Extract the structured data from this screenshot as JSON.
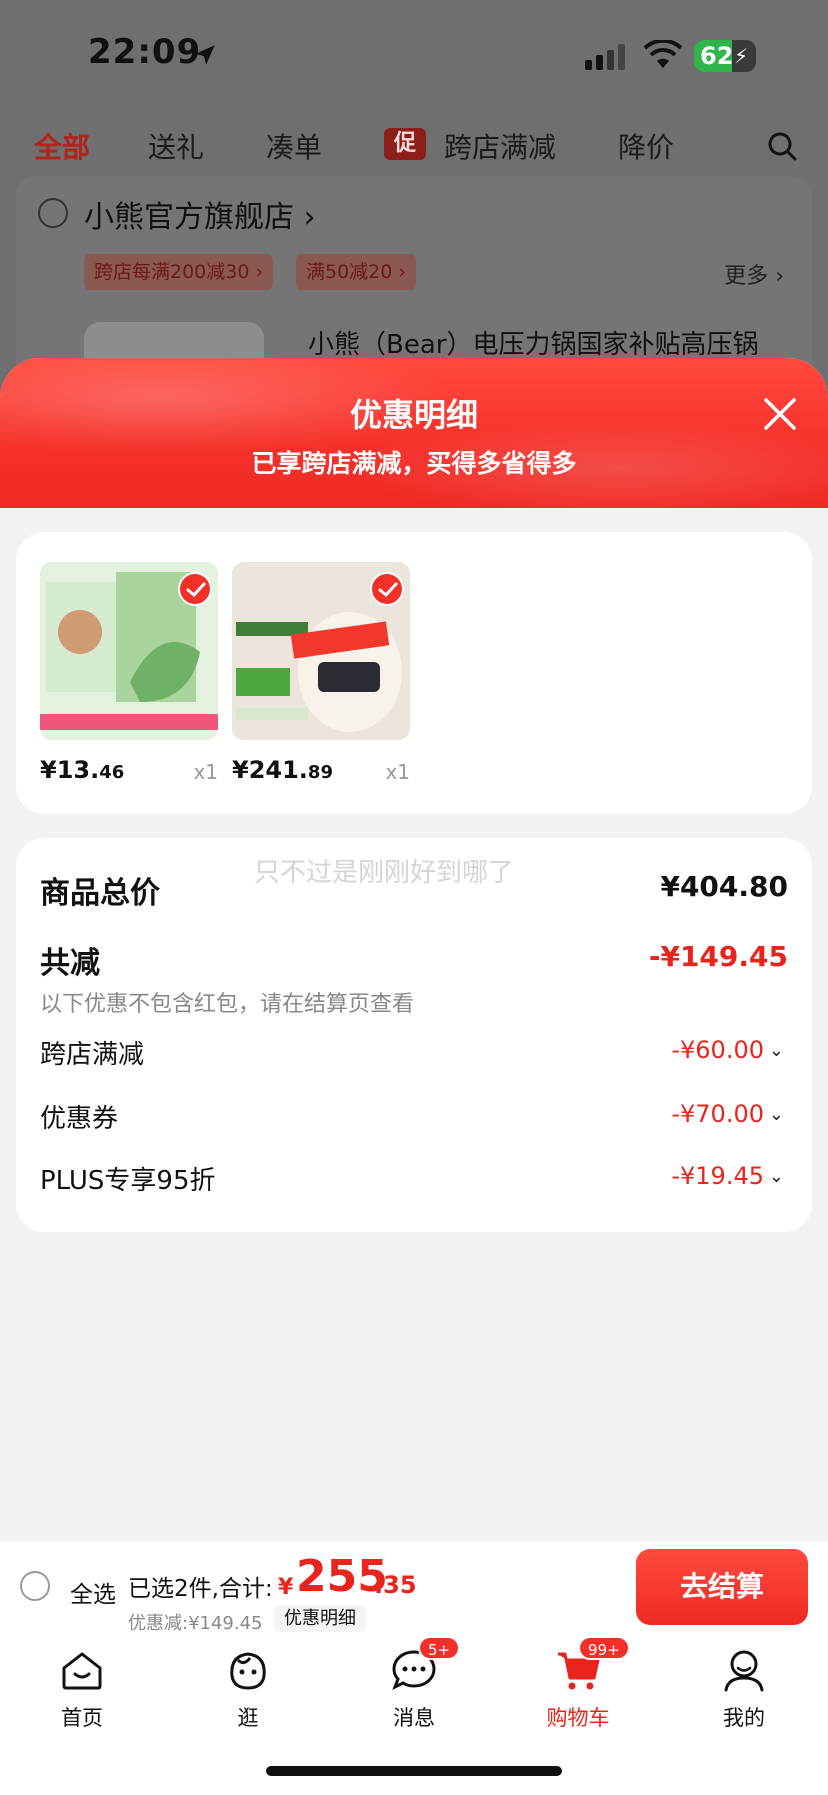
{
  "status_bar": {
    "time": "22:09",
    "battery": "62",
    "battery_level": 0.62
  },
  "top_tabs": [
    {
      "label": "全部",
      "active": true
    },
    {
      "label": "送礼"
    },
    {
      "label": "凑单"
    },
    {
      "label": "跨店满减",
      "badge": "促"
    },
    {
      "label": "降价"
    }
  ],
  "store": {
    "name": "小熊官方旗舰店 ›",
    "coupons": [
      "跨店每满200减30 ›",
      "满50减20 ›"
    ],
    "more": "更多 ›",
    "product_title": "小熊（Bear）电压力锅国家补贴高压锅"
  },
  "sheet": {
    "title": "优惠明细",
    "subtitle": "已享跨店满减，买得多省得多"
  },
  "products": [
    {
      "price_int": "¥13.",
      "price_dec": "46",
      "qty": "x1"
    },
    {
      "price_int": "¥241.",
      "price_dec": "89",
      "qty": "x1"
    }
  ],
  "summary": {
    "watermark": "只不过是刚刚好到哪了",
    "total_label": "商品总价",
    "total_value": "¥404.80",
    "reduce_label": "共减",
    "reduce_value": "-¥149.45",
    "reduce_note": "以下优惠不包含红包，请在结算页查看",
    "details": [
      {
        "label": "跨店满减",
        "value": "-¥60.00"
      },
      {
        "label": "优惠券",
        "value": "-¥70.00"
      },
      {
        "label": "PLUS专享95折",
        "value": "-¥19.45"
      }
    ]
  },
  "checkout": {
    "select_all": "全选",
    "selected_info": "已选2件,合计:",
    "currency": "¥",
    "total_int": "255",
    "total_dec": ".35",
    "discount": "优惠减:¥149.45",
    "detail_link": "优惠明细",
    "button": "去结算"
  },
  "tab_bar": [
    {
      "label": "首页"
    },
    {
      "label": "逛"
    },
    {
      "label": "消息",
      "badge": "5+"
    },
    {
      "label": "购物车",
      "badge": "99+",
      "active": true
    },
    {
      "label": "我的"
    }
  ],
  "colors": {
    "accent": "#e8241c",
    "header_red": "#f5302a"
  }
}
